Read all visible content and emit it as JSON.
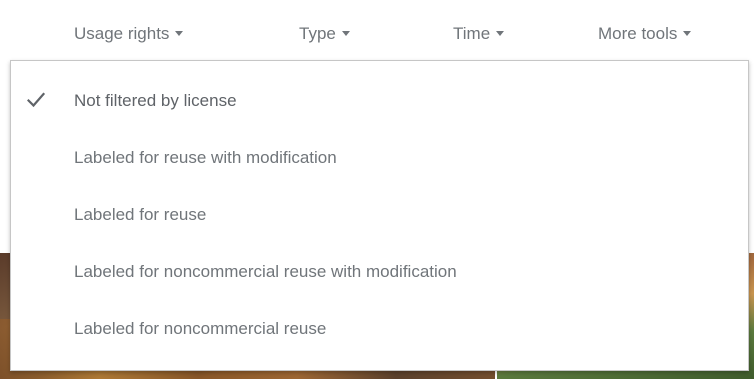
{
  "toolbar": {
    "usage_rights_label": "Usage rights",
    "type_label": "Type",
    "time_label": "Time",
    "more_tools_label": "More tools"
  },
  "menu": {
    "items": [
      {
        "label": "Not filtered by license",
        "selected": true
      },
      {
        "label": "Labeled for reuse with modification",
        "selected": false
      },
      {
        "label": "Labeled for reuse",
        "selected": false
      },
      {
        "label": "Labeled for noncommercial reuse with modification",
        "selected": false
      },
      {
        "label": "Labeled for noncommercial reuse",
        "selected": false
      }
    ]
  },
  "icons": {
    "check": "check-icon",
    "dropdown_arrow": "caret-down-icon"
  },
  "colors": {
    "text": "#70757a",
    "menu_border": "#c6c6c6",
    "background": "#ffffff"
  }
}
